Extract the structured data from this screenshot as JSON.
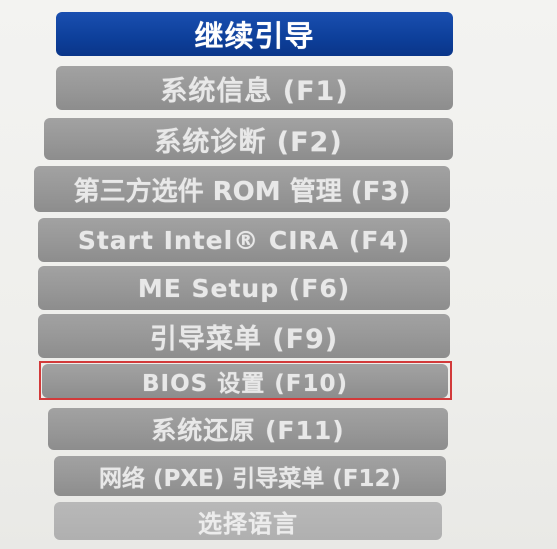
{
  "boot_menu": {
    "items": [
      {
        "label": "继续引导",
        "key": "continue-boot"
      },
      {
        "label": "系统信息 (F1)",
        "key": "system-info"
      },
      {
        "label": "系统诊断 (F2)",
        "key": "system-diagnostics"
      },
      {
        "label": "第三方选件 ROM 管理 (F3)",
        "key": "third-party-option-rom"
      },
      {
        "label": "Start Intel® CIRA (F4)",
        "key": "start-intel-cira"
      },
      {
        "label": "ME Setup (F6)",
        "key": "me-setup"
      },
      {
        "label": "引导菜单 (F9)",
        "key": "boot-menu"
      },
      {
        "label": "BIOS 设置 (F10)",
        "key": "bios-setup"
      },
      {
        "label": "系统还原 (F11)",
        "key": "system-recovery"
      },
      {
        "label": "网络 (PXE) 引导菜单 (F12)",
        "key": "network-pxe-boot"
      },
      {
        "label": "选择语言",
        "key": "select-language"
      }
    ],
    "selected_index": 0,
    "highlighted_index": 7
  },
  "colors": {
    "selected_bg": "#0d3f9a",
    "item_bg": "#979797",
    "highlight_border": "#d23a3a"
  }
}
